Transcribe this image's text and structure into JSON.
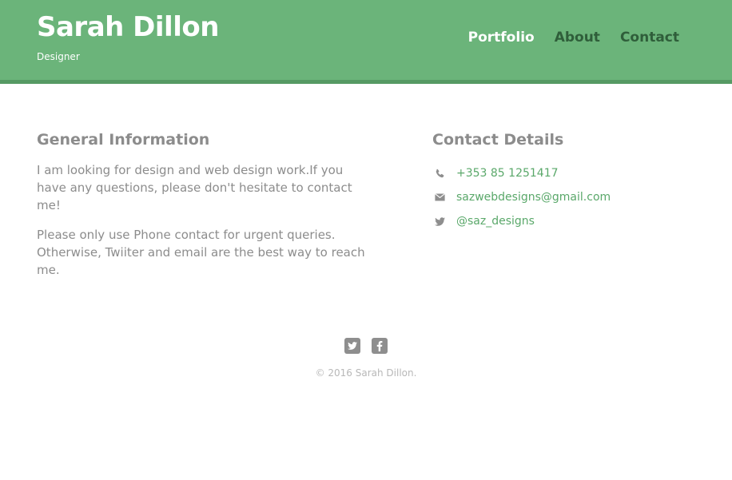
{
  "header": {
    "name": "Sarah Dillon",
    "tagline": "Designer",
    "nav": [
      {
        "label": "Portfolio"
      },
      {
        "label": "About"
      },
      {
        "label": "Contact"
      }
    ]
  },
  "general": {
    "heading": "General Information",
    "para1": "I am looking for design and web design work.If you have any questions, please don't hesitate to contact me!",
    "para2": "Please only use Phone contact for urgent queries. Otherwise, Twiiter and email are the best way to reach me."
  },
  "contact": {
    "heading": "Contact Details",
    "items": [
      {
        "icon": "phone-icon",
        "text": "+353 85 1251417"
      },
      {
        "icon": "mail-icon",
        "text": "sazwebdesigns@gmail.com"
      },
      {
        "icon": "twitter-icon",
        "text": "@saz_designs"
      }
    ]
  },
  "footer": {
    "social": [
      "twitter-icon",
      "facebook-icon"
    ],
    "copyright": "© 2016 Sarah Dillon."
  },
  "colors": {
    "header_bg": "#6bb47a",
    "header_border": "#569a64",
    "link": "#5aa86a",
    "text_muted": "#8c8c8c",
    "nav_idle": "#2f5e3a"
  }
}
